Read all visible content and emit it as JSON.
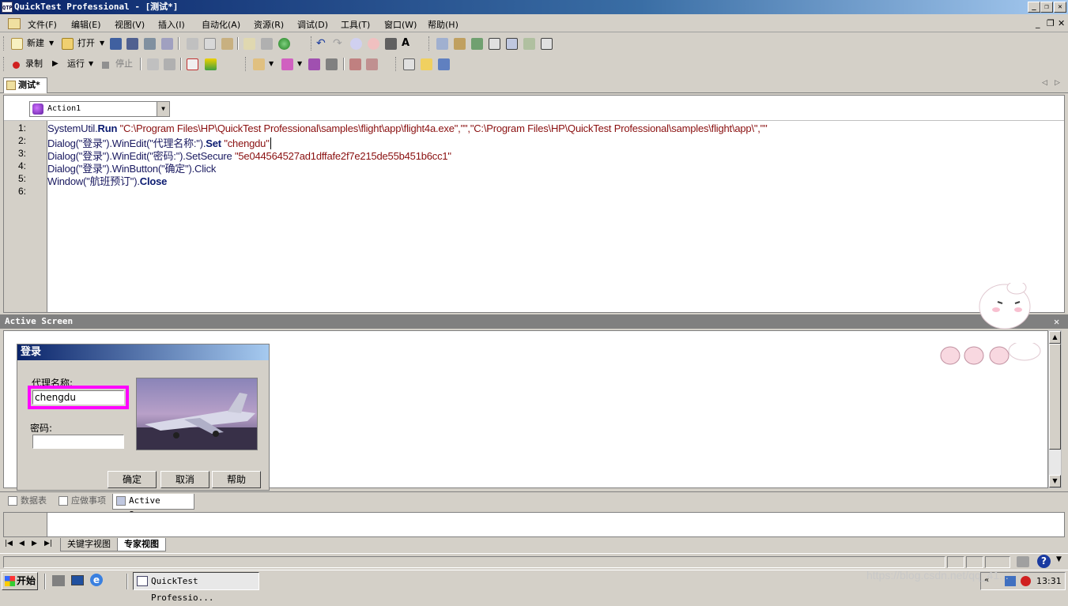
{
  "window": {
    "title": "QuickTest Professional - [测试*]",
    "app_icon": "QTP"
  },
  "menu": {
    "items": [
      "文件(F)",
      "编辑(E)",
      "视图(V)",
      "插入(I)",
      "自动化(A)",
      "资源(R)",
      "调试(D)",
      "工具(T)",
      "窗口(W)",
      "帮助(H)"
    ]
  },
  "toolbar1": {
    "new_label": "新建",
    "open_label": "打开"
  },
  "toolbar2": {
    "record_label": "录制",
    "run_label": "运行",
    "stop_label": "停止"
  },
  "document_tab": {
    "label": "测试*"
  },
  "action_select": {
    "value": "Action1"
  },
  "line_numbers": [
    "1:",
    "2:",
    "3:",
    "4:",
    "5:",
    "6:"
  ],
  "code": {
    "l1_a": "SystemUtil.",
    "l1_kw": "Run",
    "l1_str": " \"C:\\Program Files\\HP\\QuickTest Professional\\samples\\flight\\app\\flight4a.exe\",\"\",\"C:\\Program Files\\HP\\QuickTest Professional\\samples\\flight\\app\\\",\"\"",
    "l2_a": "Dialog(\"登录\").WinEdit(\"代理名称:\").",
    "l2_kw": "Set",
    "l2_str": " \"chengdu\"",
    "l3_a": "Dialog(\"登录\").WinEdit(\"密码:\").SetSecure ",
    "l3_str": "\"5e044564527ad1dffafe2f7e215de55b451b6cc1\"",
    "l4": "Dialog(\"登录\").WinButton(\"确定\").Click",
    "l5_a": "Window(\"航班预订\").",
    "l5_kw": "Close"
  },
  "active_screen": {
    "title": "Active Screen"
  },
  "login_dialog": {
    "title": "登录",
    "agent_label": "代理名称:",
    "agent_value": "chengdu",
    "password_label": "密码:",
    "password_value": "",
    "ok_label": "确定",
    "cancel_label": "取消",
    "help_label": "帮助"
  },
  "bottom_tabs": {
    "data_table": "数据表",
    "todo": "应做事项",
    "active_screen": "Active Screen"
  },
  "view_tabs": {
    "keyword": "关键字视图",
    "expert": "专家视图"
  },
  "taskbar": {
    "start_label": "开始",
    "task_label": "QuickTest Professio...",
    "clock": "13:31"
  },
  "watermark": "https://blog.csdn.net/qq_41..."
}
